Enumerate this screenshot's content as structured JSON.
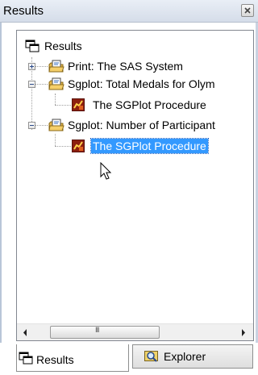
{
  "window": {
    "title": "Results"
  },
  "tree": {
    "root": {
      "label": "Results",
      "icon": "results-window-icon"
    },
    "items": [
      {
        "label": "Print:  The SAS System",
        "icon": "folder-report-icon",
        "expanded": false
      },
      {
        "label": "Sgplot:  Total Medals for Olym",
        "icon": "folder-report-icon",
        "expanded": true,
        "child": {
          "label": "The SGPlot Procedure",
          "icon": "graph-output-icon",
          "selected": false
        }
      },
      {
        "label": "Sgplot:  Number of Participant",
        "icon": "folder-report-icon",
        "expanded": true,
        "child": {
          "label": "The SGPlot Procedure",
          "icon": "graph-output-icon",
          "selected": true
        }
      }
    ]
  },
  "scrollbar": {
    "middle_glyph": "III"
  },
  "tabs": [
    {
      "label": "Results",
      "icon": "results-window-icon",
      "active": true
    },
    {
      "label": "Explorer",
      "icon": "explorer-icon",
      "active": false
    }
  ],
  "colors": {
    "selection": "#3399ff",
    "titlebar": "#dfe6f1"
  }
}
